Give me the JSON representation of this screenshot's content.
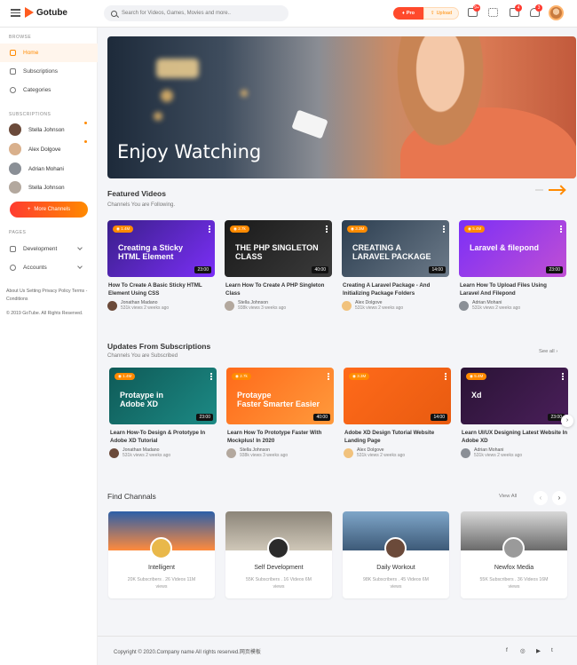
{
  "app": {
    "name": "Gotube",
    "search_placeholder": "Search for Videos, Games, Movies and more..",
    "pro_label": "Pro",
    "upload_label": "Upload",
    "badges": [
      "9+",
      "4",
      "3"
    ]
  },
  "sidebar": {
    "browse_heading": "BROWSE",
    "items": [
      {
        "label": "Home",
        "icon": "home-icon"
      },
      {
        "label": "Subscriptions",
        "icon": "subscriptions-icon"
      },
      {
        "label": "Categories",
        "icon": "gear-icon"
      }
    ],
    "subs_heading": "SUBSCRIPTIONS",
    "subs": [
      {
        "name": "Stella Johnson",
        "dot": true
      },
      {
        "name": "Alex Dolgove",
        "dot": true
      },
      {
        "name": "Adrian Mohani",
        "dot": false
      },
      {
        "name": "Stella Johnson",
        "dot": false
      }
    ],
    "more_label": "More Channels",
    "pages_heading": "PAGES",
    "pages": [
      {
        "label": "Development"
      },
      {
        "label": "Accounts"
      }
    ],
    "links": "About Us   Setting   Privacy Policy   Terms - Conditions",
    "copyright": "© 2019 GoTube. All Rights Reserved."
  },
  "hero": {
    "title": "Enjoy Watching"
  },
  "featured": {
    "title": "Featured Videos",
    "subtitle": "Channels You are Following.",
    "videos": [
      {
        "badge": "1.4M",
        "dur": "23:00",
        "thumb_text": "Creating a Sticky\nHTML Element",
        "title": "How To Create A Basic Sticky HTML Element Using CSS",
        "channel": "Jonathan Madano",
        "stats": "531k views 2 weeks ago"
      },
      {
        "badge": "2.7k",
        "dur": "40:00",
        "thumb_text": "THE PHP SINGLETON\nCLASS",
        "title": "Learn How To Create A PHP Singleton Class",
        "channel": "Stella Johnson",
        "stats": "938k views 3 weeks ago"
      },
      {
        "badge": "3.3M",
        "dur": "14:00",
        "thumb_text": "CREATING A\nLARAVEL PACKAGE",
        "title": "Creating A Laravel Package - And Initializing Package Folders",
        "channel": "Alex Dolgove",
        "stats": "531k views 2 weeks ago"
      },
      {
        "badge": "5.4M",
        "dur": "23:00",
        "thumb_text": "Laravel & filepond",
        "title": "Learn How To Upload Files Using Laravel And Filepond",
        "channel": "Adrian Mohani",
        "stats": "531k views 2 weeks ago"
      }
    ]
  },
  "updates": {
    "title": "Updates From Subscriptions",
    "subtitle": "Channels You are Subscribed",
    "see_all": "See all",
    "videos": [
      {
        "badge": "1.4M",
        "dur": "23:00",
        "thumb_text": "Protaypе in\nAdobe XD",
        "title": "Learn How-To Design & Prototype In Adobe XD Tutorial",
        "channel": "Jonathan Madano",
        "stats": "531k views 2 weeks ago"
      },
      {
        "badge": "2.7k",
        "dur": "40:00",
        "thumb_text": "Protaype\nFaster Smarter Easier",
        "title": "Learn How To Prototype Faster With Mockplus! In 2020",
        "channel": "Stella Johnson",
        "stats": "938k views 3 weeks ago"
      },
      {
        "badge": "3.3M",
        "dur": "14:00",
        "thumb_text": "",
        "title": "Adobe XD Design Tutorial Website Landing Page",
        "channel": "Alex Dolgove",
        "stats": "531k views 2 weeks ago"
      },
      {
        "badge": "5.4M",
        "dur": "23:00",
        "thumb_text": "Xd",
        "title": "Learn UI/UX Designing Latest Website In Adobe XD",
        "channel": "Adrian Mohani",
        "stats": "531k views 2 weeks ago"
      }
    ]
  },
  "channels": {
    "title": "Find Channals",
    "view_all": "View All",
    "items": [
      {
        "name": "Intelligent",
        "stats": "20K Subscribers . 26 Videos 11M views"
      },
      {
        "name": "Self Development",
        "stats": "55K Subscribers . 16 Videos 6M views"
      },
      {
        "name": "Daily Workout",
        "stats": "98K Subscribers . 45 Videos 6M views"
      },
      {
        "name": "Newfox Media",
        "stats": "55K Subscribers . 36 Videos 16M views"
      }
    ]
  },
  "footer": {
    "copyright": "Copyright © 2020.Company name All rights reserved.网页模板",
    "social": [
      "f",
      "◎",
      "▶",
      "t"
    ]
  }
}
